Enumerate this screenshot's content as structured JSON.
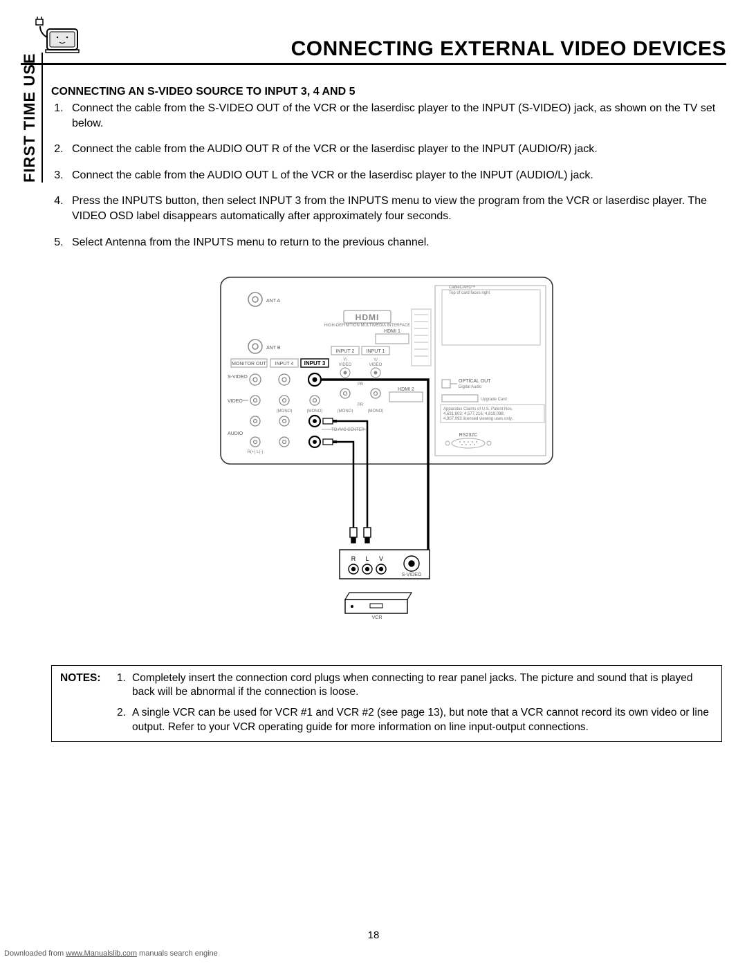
{
  "header": {
    "title": "CONNECTING EXTERNAL VIDEO DEVICES"
  },
  "side_label": "FIRST TIME USE",
  "section": {
    "title": "CONNECTING AN S-VIDEO SOURCE TO INPUT 3, 4 AND 5",
    "steps": [
      "Connect the cable from the S-VIDEO OUT of the VCR or the laserdisc player to the INPUT (S-VIDEO) jack, as shown on the TV set below.",
      "Connect the cable from the AUDIO OUT R of the VCR or the laserdisc player to the INPUT (AUDIO/R) jack.",
      "Connect the cable from the AUDIO OUT L of the VCR or the laserdisc player to the INPUT (AUDIO/L) jack.",
      "Press the INPUTS button, then select INPUT 3 from the INPUTS menu to view the program from the VCR or laserdisc player.  The VIDEO OSD label disappears automatically after approximately four seconds.",
      "Select Antenna from the INPUTS menu to return to the previous channel."
    ]
  },
  "diagram": {
    "panel": {
      "ant_a": "ANT A",
      "ant_b": "ANT B",
      "hdmi_logo": "HDMI",
      "hdmi_sub": "HIGH-DEFINITION MULTIMEDIA INTERFACE",
      "hdmi1": "HDMI 1",
      "hdmi2": "HDMI 2",
      "input1": "INPUT 1",
      "input2": "INPUT 2",
      "input3": "INPUT 3",
      "input4": "INPUT 4",
      "monitor_out": "MONITOR OUT",
      "svideo": "S-VIDEO",
      "video": "VIDEO",
      "audio": "AUDIO",
      "mono": "(MONO)",
      "y_video": "Y/\nVIDEO",
      "pb": "PB",
      "pr": "PR",
      "tvavcenter": "TO AVC CENTER",
      "rl_sub": "R(+)\nL(-)",
      "cablecard": "CableCARD™\nTop of card faces right",
      "optical": "OPTICAL OUT",
      "optical_sub": "Digital Audio",
      "upgrade": "Upgrade Card",
      "rs232": "RS232C",
      "apparatus": "Apparatus Claims of U.S. Patent Nos. 4,631,603; 4,577,216; 4,819,098 and 4,907,093 licensed for limited viewing uses only."
    },
    "lower": {
      "r": "R",
      "l": "L",
      "v": "V",
      "svideo": "S-VIDEO",
      "vcr": "VCR"
    }
  },
  "notes": {
    "label": "NOTES:",
    "items": [
      "Completely insert the connection cord plugs when connecting to rear panel jacks.  The picture and sound that is played back will be abnormal if the connection is loose.",
      "A single VCR can be used for VCR #1 and VCR #2 (see page 13), but note that a VCR cannot record its own video or line output.  Refer to your VCR operating guide for more information on line input-output connections."
    ]
  },
  "page_number": "18",
  "footer": {
    "prefix": "Downloaded from ",
    "link": "www.Manualslib.com",
    "suffix": " manuals search engine"
  }
}
